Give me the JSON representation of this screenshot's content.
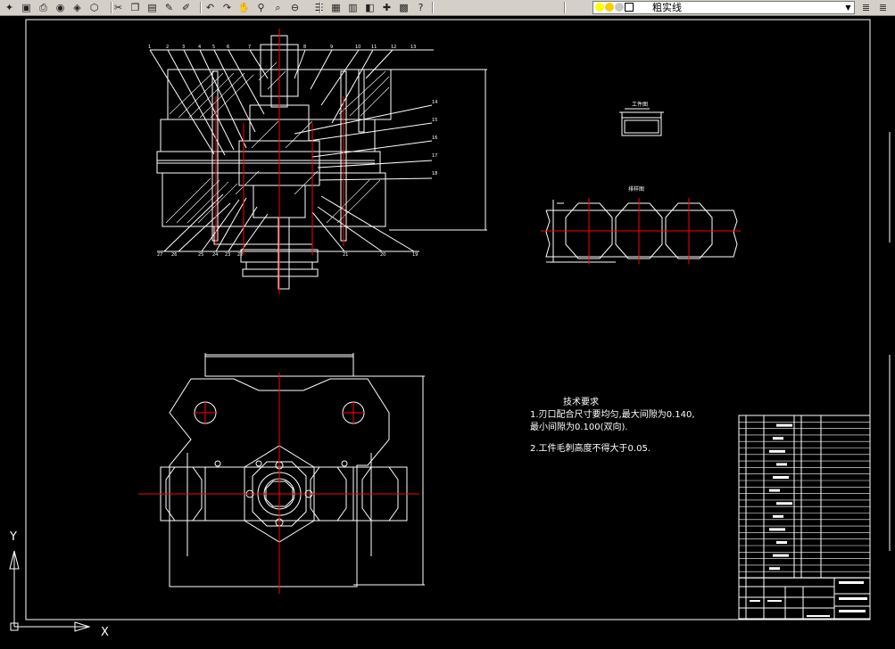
{
  "toolbar": {
    "layer_name": "粗实线",
    "buttons": [
      {
        "name": "new-icon",
        "glyph": "✦"
      },
      {
        "name": "save-icon",
        "glyph": "▣"
      },
      {
        "name": "print-icon",
        "glyph": "⎙"
      },
      {
        "name": "preview-icon",
        "glyph": "◉"
      },
      {
        "name": "publish-icon",
        "glyph": "◈"
      },
      {
        "name": "plot-icon",
        "glyph": "⬡"
      },
      {
        "name": "cut-icon",
        "glyph": "✂"
      },
      {
        "name": "copy-icon",
        "glyph": "❐"
      },
      {
        "name": "paste-icon",
        "glyph": "▤"
      },
      {
        "name": "match-prop-icon",
        "glyph": "✎"
      },
      {
        "name": "block-edit-icon",
        "glyph": "✐"
      },
      {
        "name": "undo-icon",
        "glyph": "↶"
      },
      {
        "name": "redo-icon",
        "glyph": "↷"
      },
      {
        "name": "pan-icon",
        "glyph": "✋"
      },
      {
        "name": "zoom-realtime-icon",
        "glyph": "⚲"
      },
      {
        "name": "zoom-window-icon",
        "glyph": "⌕"
      },
      {
        "name": "zoom-previous-icon",
        "glyph": "⊖"
      },
      {
        "name": "properties-icon",
        "glyph": "☰"
      },
      {
        "name": "design-center-icon",
        "glyph": "▦"
      },
      {
        "name": "tool-palette-icon",
        "glyph": "▥"
      },
      {
        "name": "sheet-set-icon",
        "glyph": "◧"
      },
      {
        "name": "markup-icon",
        "glyph": "✚"
      },
      {
        "name": "calculator-icon",
        "glyph": "▩"
      },
      {
        "name": "help-icon",
        "glyph": "?"
      }
    ]
  },
  "ucs": {
    "y_label": "Y",
    "x_label": "X"
  },
  "drawing": {
    "tech_title": "技术要求",
    "tech_line1": "1.刃口配合尺寸要均匀,最大间隙为0.140,",
    "tech_line2": "最小间隙为0.100(双向).",
    "tech_line3": "2.工件毛刺高度不得大于0.05.",
    "callouts_top": [
      "1",
      "2",
      "3",
      "4",
      "5",
      "6",
      "7",
      "8",
      "9",
      "10",
      "11",
      "12",
      "13"
    ],
    "callouts_right": [
      "14",
      "15",
      "16",
      "17",
      "18"
    ],
    "callouts_bottom": [
      "27",
      "26",
      "25",
      "24",
      "23",
      "22",
      "21",
      "20",
      "19"
    ],
    "workpiece_label": "工件图",
    "layout_label": "排样图"
  },
  "colors": {
    "toolbar_bg": "#d4d0c8",
    "canvas_bg": "#000000",
    "line_white": "#ffffff",
    "center_red": "#ff0000",
    "layer_yellow": "#ffff00"
  }
}
